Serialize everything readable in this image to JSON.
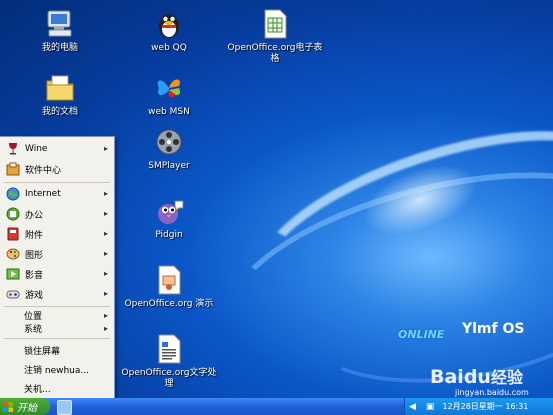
{
  "desktop_icons": [
    {
      "id": "my-computer",
      "label": "我的电脑"
    },
    {
      "id": "my-documents",
      "label": "我的文档"
    },
    {
      "id": "web-qq",
      "label": "web QQ"
    },
    {
      "id": "web-msn",
      "label": "web MSN"
    },
    {
      "id": "smplayer",
      "label": "SMPlayer"
    },
    {
      "id": "pidgin",
      "label": "Pidgin"
    },
    {
      "id": "oo-impress",
      "label": "OpenOffice.org 演示"
    },
    {
      "id": "oo-writer",
      "label": "OpenOffice.org文字处理"
    },
    {
      "id": "oo-calc",
      "label": "OpenOffice.org电子表格"
    }
  ],
  "start_menu": {
    "items": [
      {
        "label": "Wine",
        "submenu": true
      },
      {
        "label": "软件中心",
        "submenu": false
      },
      {
        "label": "Internet",
        "submenu": true
      },
      {
        "label": "办公",
        "submenu": true
      },
      {
        "label": "附件",
        "submenu": true
      },
      {
        "label": "图形",
        "submenu": true
      },
      {
        "label": "影音",
        "submenu": true
      },
      {
        "label": "游戏",
        "submenu": true
      },
      {
        "label": "位置",
        "submenu": true
      },
      {
        "label": "系统",
        "submenu": true
      },
      {
        "label": "锁住屏幕",
        "submenu": false
      },
      {
        "label": "注销 newhua...",
        "submenu": false
      },
      {
        "label": "关机...",
        "submenu": false
      }
    ]
  },
  "taskbar": {
    "start_label": "开始",
    "clock": "12月28日星期一 16:31"
  },
  "watermarks": {
    "brand": "Ylmf OS",
    "brand_sub": "ONLINE",
    "baidu": "Baidu",
    "baidu_cn": "经验",
    "url": "jingyan.baidu.com"
  },
  "colors": {
    "taskbar": "#1f5fd9",
    "start_button": "#2f8d24",
    "menu_bg": "#f2f1ec"
  }
}
